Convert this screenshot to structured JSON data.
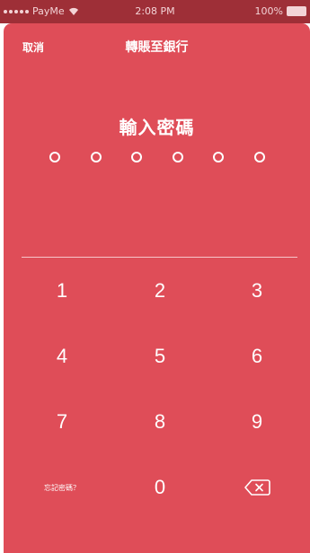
{
  "status_bar": {
    "carrier": "PayMe",
    "time": "2:08 PM",
    "battery": "100%"
  },
  "header": {
    "cancel_label": "取消",
    "title": "轉賬至銀行"
  },
  "pin": {
    "heading": "輸入密碼",
    "length": 6,
    "entered": 0
  },
  "keypad": {
    "keys": [
      "1",
      "2",
      "3",
      "4",
      "5",
      "6",
      "7",
      "8",
      "9"
    ],
    "forgot_label": "忘記密碼？",
    "zero": "0",
    "delete_icon": "backspace-icon"
  },
  "colors": {
    "background": "#df4d58",
    "status_bar": "#9e2f37",
    "text": "#ffffff"
  }
}
